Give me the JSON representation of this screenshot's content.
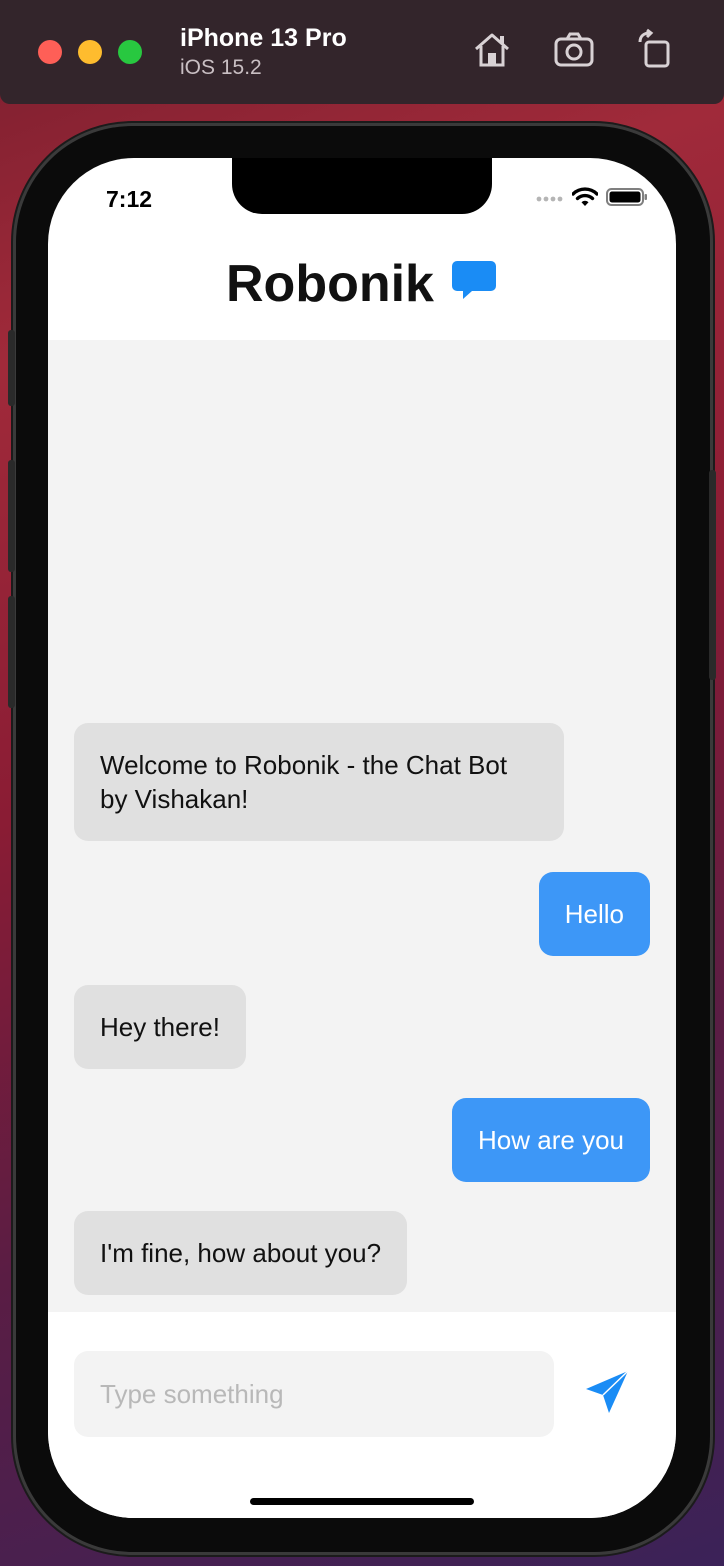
{
  "simulator": {
    "device_name": "iPhone 13 Pro",
    "os_version": "iOS 15.2",
    "icons": [
      "home-icon",
      "screenshot-icon",
      "rotate-icon"
    ]
  },
  "status_bar": {
    "time": "7:12",
    "icons": [
      "signal-icon",
      "wifi-icon",
      "battery-icon"
    ]
  },
  "header": {
    "title": "Robonik",
    "icon": "chat-bubble-icon",
    "icon_color": "#1a8cf5"
  },
  "messages": [
    {
      "sender": "bot",
      "text": "Welcome to Robonik - the Chat Bot by Vishakan!"
    },
    {
      "sender": "user",
      "text": "Hello"
    },
    {
      "sender": "bot",
      "text": "Hey there!"
    },
    {
      "sender": "user",
      "text": "How are you"
    },
    {
      "sender": "bot",
      "text": "I'm fine, how about you?"
    }
  ],
  "input": {
    "placeholder": "Type something",
    "value": "",
    "send_icon": "send-icon"
  },
  "colors": {
    "user_bubble": "#3d97f7",
    "bot_bubble": "#e0e0e0",
    "chat_background": "#f3f3f3",
    "accent": "#1a8cf5"
  }
}
